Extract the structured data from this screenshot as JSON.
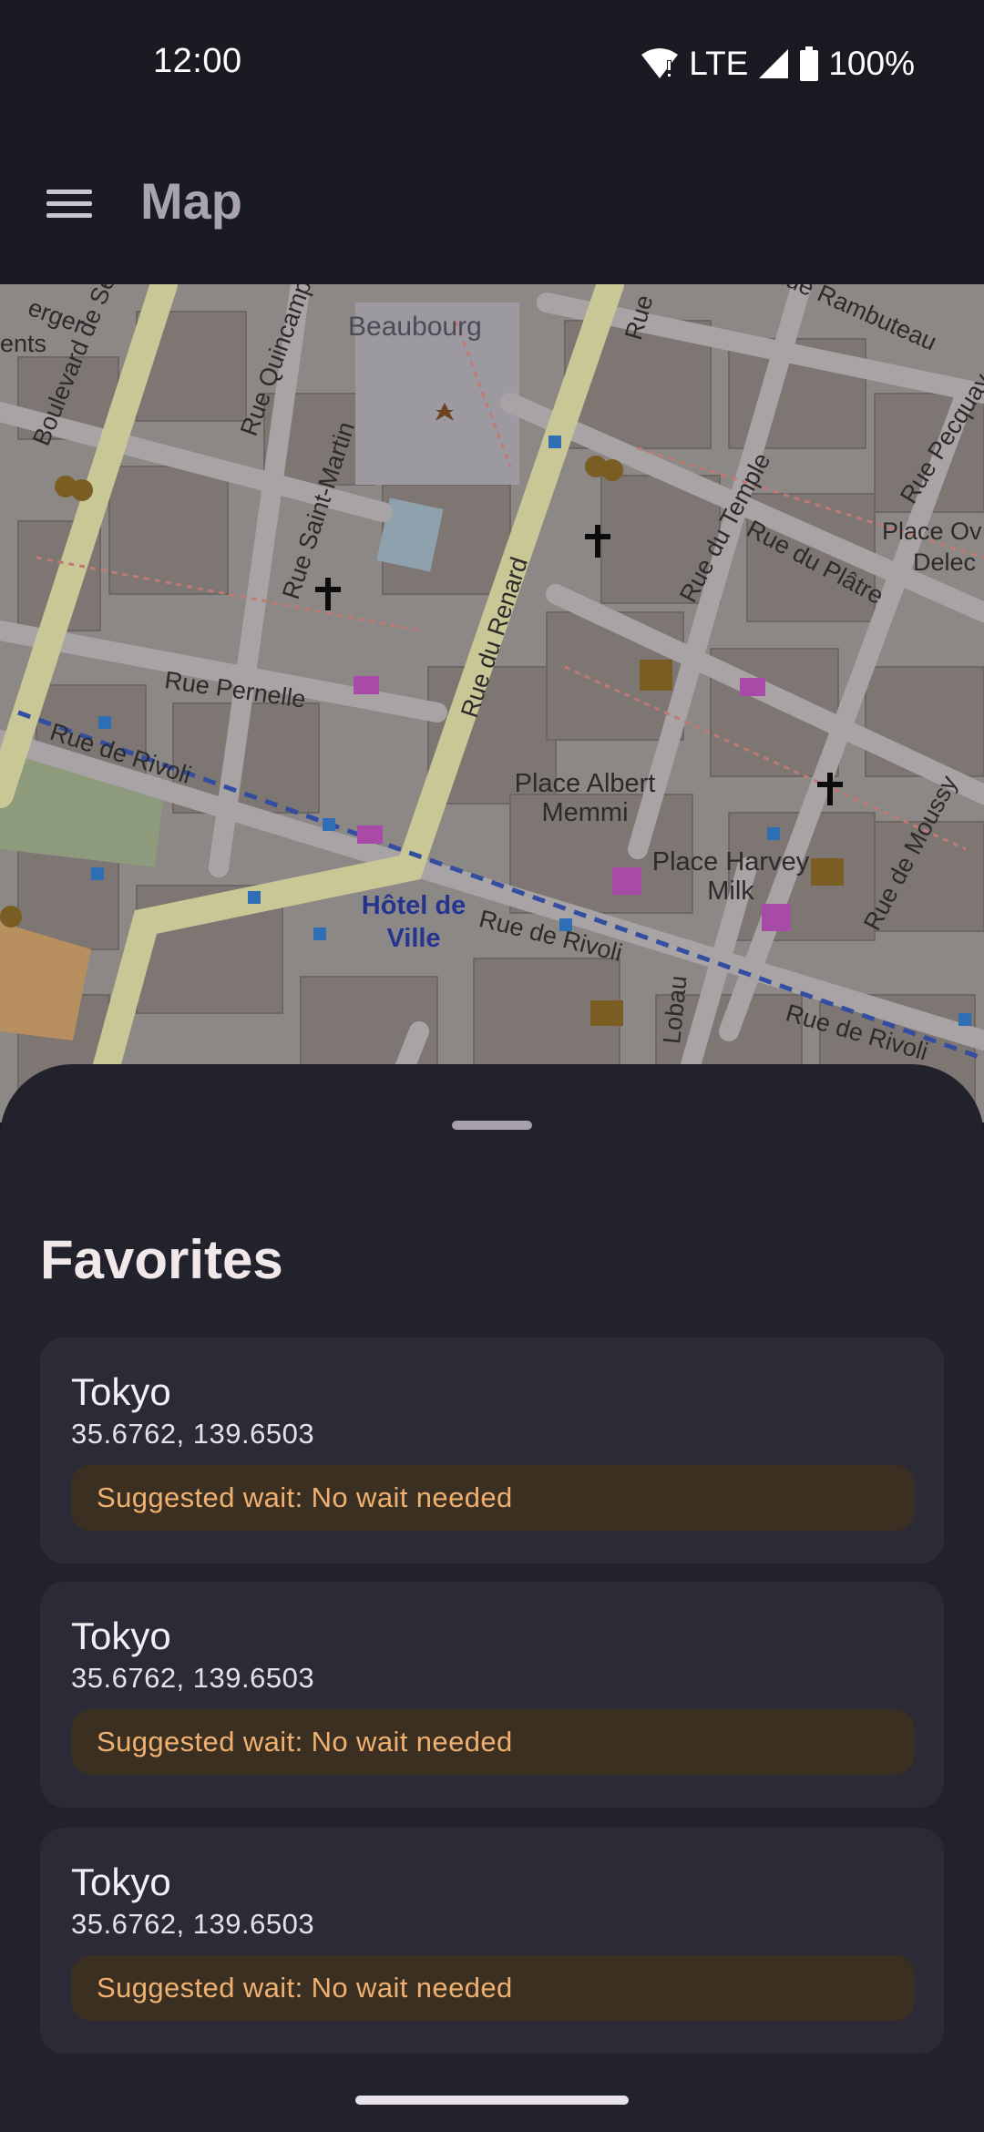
{
  "status_bar": {
    "time": "12:00",
    "network": "LTE",
    "battery": "100%",
    "icons": [
      "wifi-warning-icon",
      "signal-icon",
      "battery-icon"
    ]
  },
  "app_bar": {
    "menu_icon": "hamburger-menu-icon",
    "title": "Map"
  },
  "map": {
    "labels": {
      "beaubourg": "Beaubourg",
      "bd_sebastopol": "Boulevard de Sébastopol",
      "rue_quincampoix": "Rue Quincampoix",
      "rue_saint_martin": "Rue Saint-Martin",
      "rue_du_renard": "Rue du Renard",
      "rue_pernelle": "Rue Pernelle",
      "rue_de_rivoli_left": "Rue de Rivoli",
      "rue_de_rivoli_mid": "Rue de Rivoli",
      "rue_de_rivoli_right": "Rue de Rivoli",
      "rue_du_temple": "Rue du Temple",
      "rue_du_platre": "Rue du Plâtre",
      "rue_pecquay": "Rue Pecquay",
      "rue_rambuteau": "Rue Rambuteau",
      "rue_de_moussy": "Rue de Moussy",
      "rue_lobau": "Lobau",
      "rue_top": "Rue",
      "place_ov": "Place Ov",
      "delec": "Delec",
      "place_albert_memmi_1": "Place Albert",
      "place_albert_memmi_2": "Memmi",
      "place_harvey_milk_1": "Place Harvey",
      "place_harvey_milk_2": "Milk",
      "hotel_de_ville_1": "Hôtel de",
      "hotel_de_ville_2": "Ville",
      "erger": "erger",
      "ents": "ents"
    }
  },
  "favorites": {
    "title": "Favorites",
    "items": [
      {
        "name": "Tokyo",
        "coords": "35.6762, 139.6503",
        "wait": "Suggested wait: No wait needed"
      },
      {
        "name": "Tokyo",
        "coords": "35.6762, 139.6503",
        "wait": "Suggested wait: No wait needed"
      },
      {
        "name": "Tokyo",
        "coords": "35.6762, 139.6503",
        "wait": "Suggested wait: No wait needed"
      }
    ]
  },
  "colors": {
    "background": "#1a1b22",
    "sheet": "#22222c",
    "card": "#2b2a36",
    "chip": "#3a2f20",
    "chip_text": "#f0b071"
  }
}
